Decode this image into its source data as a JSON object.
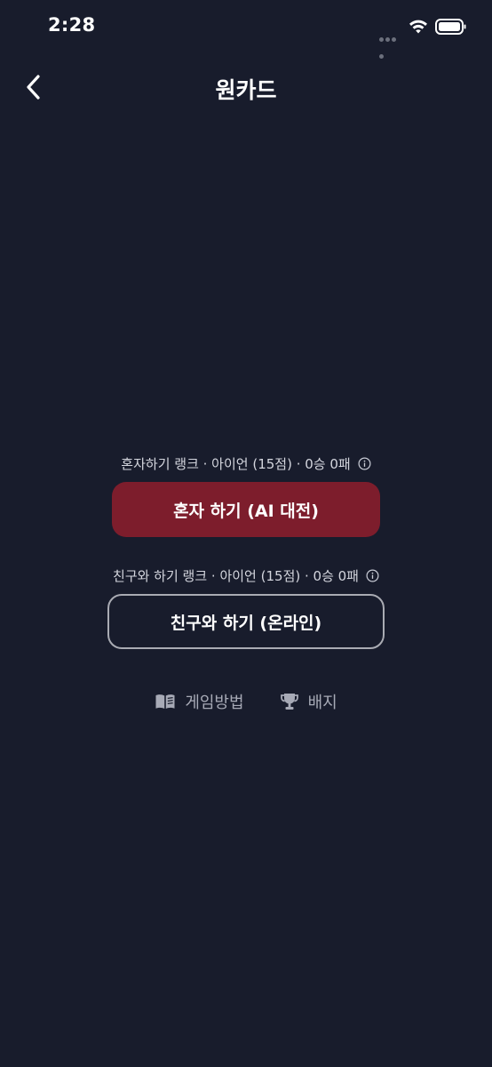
{
  "status_bar": {
    "time": "2:28"
  },
  "header": {
    "title": "원카드",
    "back_icon": "chevron-left-icon"
  },
  "solo": {
    "rank_text": "혼자하기 랭크 · 아이언 (15점) · 0승 0패",
    "button_label": "혼자 하기 (AI 대전)",
    "button_color": "#7d1d2c"
  },
  "friend": {
    "rank_text": "친구와 하기 랭크 · 아이언 (15점) · 0승 0패",
    "button_label": "친구와 하기 (온라인)"
  },
  "links": {
    "how_to_play": "게임방법",
    "badges": "배지"
  },
  "colors": {
    "background": "#181c2c",
    "muted_text": "#a7aab6"
  }
}
